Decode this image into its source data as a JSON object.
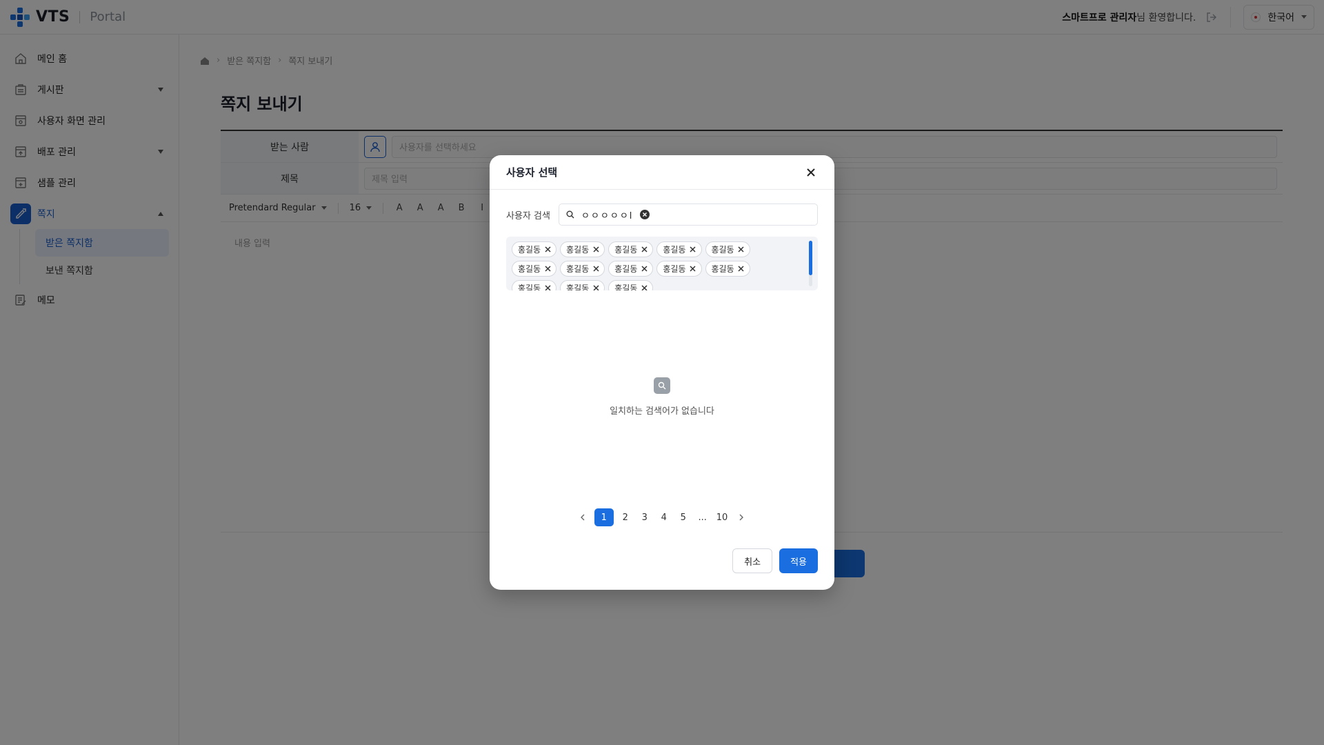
{
  "header": {
    "logo_text": "VTS",
    "logo_sub": "Portal",
    "welcome_name": "스마트프로 관리자",
    "welcome_suffix": "님 환영합니다.",
    "language": "한국어"
  },
  "sidebar": {
    "items": [
      {
        "label": "메인 홈"
      },
      {
        "label": "게시판"
      },
      {
        "label": "사용자 화면 관리"
      },
      {
        "label": "배포 관리"
      },
      {
        "label": "샘플 관리"
      },
      {
        "label": "쪽지"
      },
      {
        "label": "메모"
      }
    ],
    "sub_items": [
      {
        "label": "받은 쪽지함"
      },
      {
        "label": "보낸 쪽지함"
      }
    ]
  },
  "main": {
    "breadcrumb": [
      "받은 쪽지함",
      "쪽지 보내기"
    ],
    "title": "쪽지 보내기",
    "form": {
      "recipient_label": "받는 사람",
      "recipient_placeholder": "사용자를 선택하세요",
      "subject_label": "제목",
      "subject_placeholder": "제목 입력",
      "font_family": "Pretendard Regular",
      "font_size": "16",
      "body_placeholder": "내용 입력"
    }
  },
  "modal": {
    "title": "사용자 선택",
    "search_label": "사용자 검색",
    "search_value": "ㅇㅇㅇㅇㅇl",
    "chips": [
      "홍길동",
      "홍길동",
      "홍길동",
      "홍길동",
      "홍길동",
      "홍길동",
      "홍길동",
      "홍길동",
      "홍길동",
      "홍길동",
      "홍길동",
      "홍길동",
      "홍길동"
    ],
    "empty_text": "일치하는 검색어가 없습니다",
    "pages": [
      "1",
      "2",
      "3",
      "4",
      "5",
      "...",
      "10"
    ],
    "current_page": "1",
    "cancel_label": "취소",
    "apply_label": "적용"
  },
  "colors": {
    "accent": "#1a6ee0",
    "sidebar_active_bg": "#eaf1fc"
  }
}
